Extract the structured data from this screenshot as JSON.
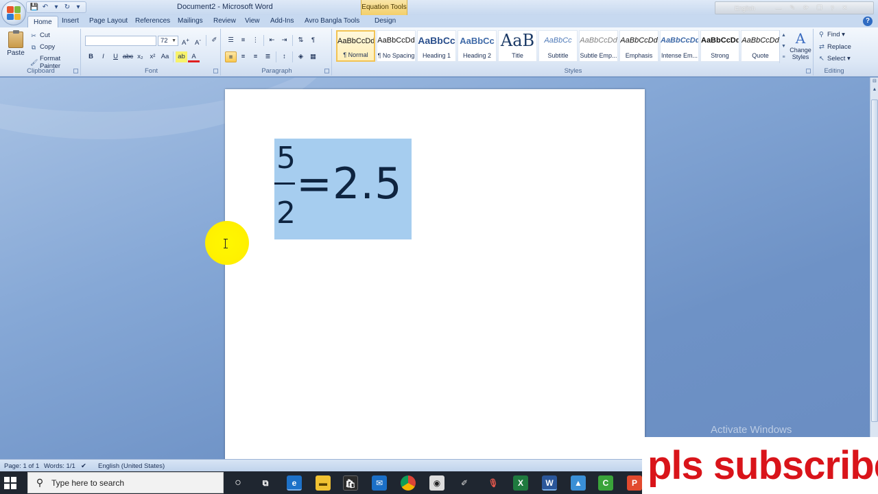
{
  "window": {
    "title": "Document2 - Microsoft Word",
    "contextual_tab_group": "Equation Tools",
    "language_indicator": "English"
  },
  "tabs": [
    "Home",
    "Insert",
    "Page Layout",
    "References",
    "Mailings",
    "Review",
    "View",
    "Add-Ins",
    "Avro Bangla Tools",
    "Design"
  ],
  "active_tab": "Home",
  "ribbon": {
    "clipboard": {
      "label": "Clipboard",
      "paste": "Paste",
      "cut": "Cut",
      "copy": "Copy",
      "format_painter": "Format Painter"
    },
    "font": {
      "label": "Font",
      "font_name": "",
      "font_size": "72"
    },
    "paragraph": {
      "label": "Paragraph"
    },
    "styles": {
      "label": "Styles",
      "items": [
        {
          "sample": "AaBbCcDd",
          "name": "¶ Normal"
        },
        {
          "sample": "AaBbCcDd",
          "name": "¶ No Spacing"
        },
        {
          "sample": "AaBbCc",
          "name": "Heading 1"
        },
        {
          "sample": "AaBbCc",
          "name": "Heading 2"
        },
        {
          "sample": "AaB",
          "name": "Title"
        },
        {
          "sample": "AaBbCc",
          "name": "Subtitle"
        },
        {
          "sample": "AaBbCcDd",
          "name": "Subtle Emp..."
        },
        {
          "sample": "AaBbCcDd",
          "name": "Emphasis"
        },
        {
          "sample": "AaBbCcDd",
          "name": "Intense Em..."
        },
        {
          "sample": "AaBbCcDd",
          "name": "Strong"
        },
        {
          "sample": "AaBbCcDd",
          "name": "Quote"
        }
      ],
      "change_styles": "Change Styles"
    },
    "editing": {
      "label": "Editing",
      "find": "Find",
      "replace": "Replace",
      "select": "Select"
    }
  },
  "document": {
    "equation": {
      "numerator": "5",
      "denominator": "2",
      "rest": "=2.5"
    }
  },
  "watermark": "Activate Windows",
  "statusbar": {
    "page": "Page: 1 of 1",
    "words": "Words: 1/1",
    "language": "English (United States)"
  },
  "taskbar": {
    "search_placeholder": "Type here to search"
  },
  "overlay": {
    "text": "pls subscribe"
  },
  "colors": {
    "selection": "#a6cdef",
    "equation_text": "#0e2440",
    "subscribe_red": "#d9141a",
    "cursor_highlight": "#fff200"
  }
}
